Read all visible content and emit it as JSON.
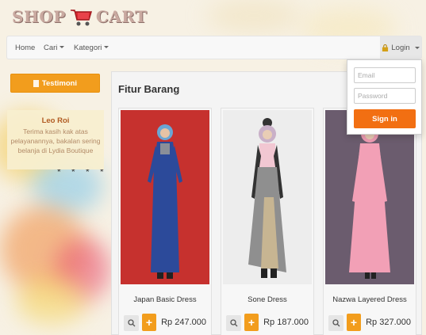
{
  "logo": {
    "word_left": "SHOP",
    "word_right": "CART",
    "icon": "shopping-cart-icon"
  },
  "navbar": {
    "home": "Home",
    "cari": "Cari",
    "kategori": "Kategori",
    "login": "Login",
    "login_icon": "lock-icon"
  },
  "login_form": {
    "email_placeholder": "Email",
    "password_placeholder": "Password",
    "signin_label": "Sign in"
  },
  "sidebar": {
    "testimoni_label": "Testimoni",
    "testimoni_icon": "document-icon",
    "testimonial": {
      "name": "Leo Roi",
      "text": "Terima kasih kak atas pelayanannya, bakalan sering belanja di Lydia Boutique"
    }
  },
  "main": {
    "title": "Fitur Barang",
    "products": [
      {
        "name": "Japan Basic Dress",
        "price": "Rp 247.000"
      },
      {
        "name": "Sone Dress",
        "price": "Rp 187.000"
      },
      {
        "name": "Nazwa Layered Dress",
        "price": "Rp 327.000"
      }
    ]
  },
  "colors": {
    "accent_orange": "#f29d1d",
    "signin_orange": "#f26f12",
    "testimonial_name": "#b15b22"
  }
}
